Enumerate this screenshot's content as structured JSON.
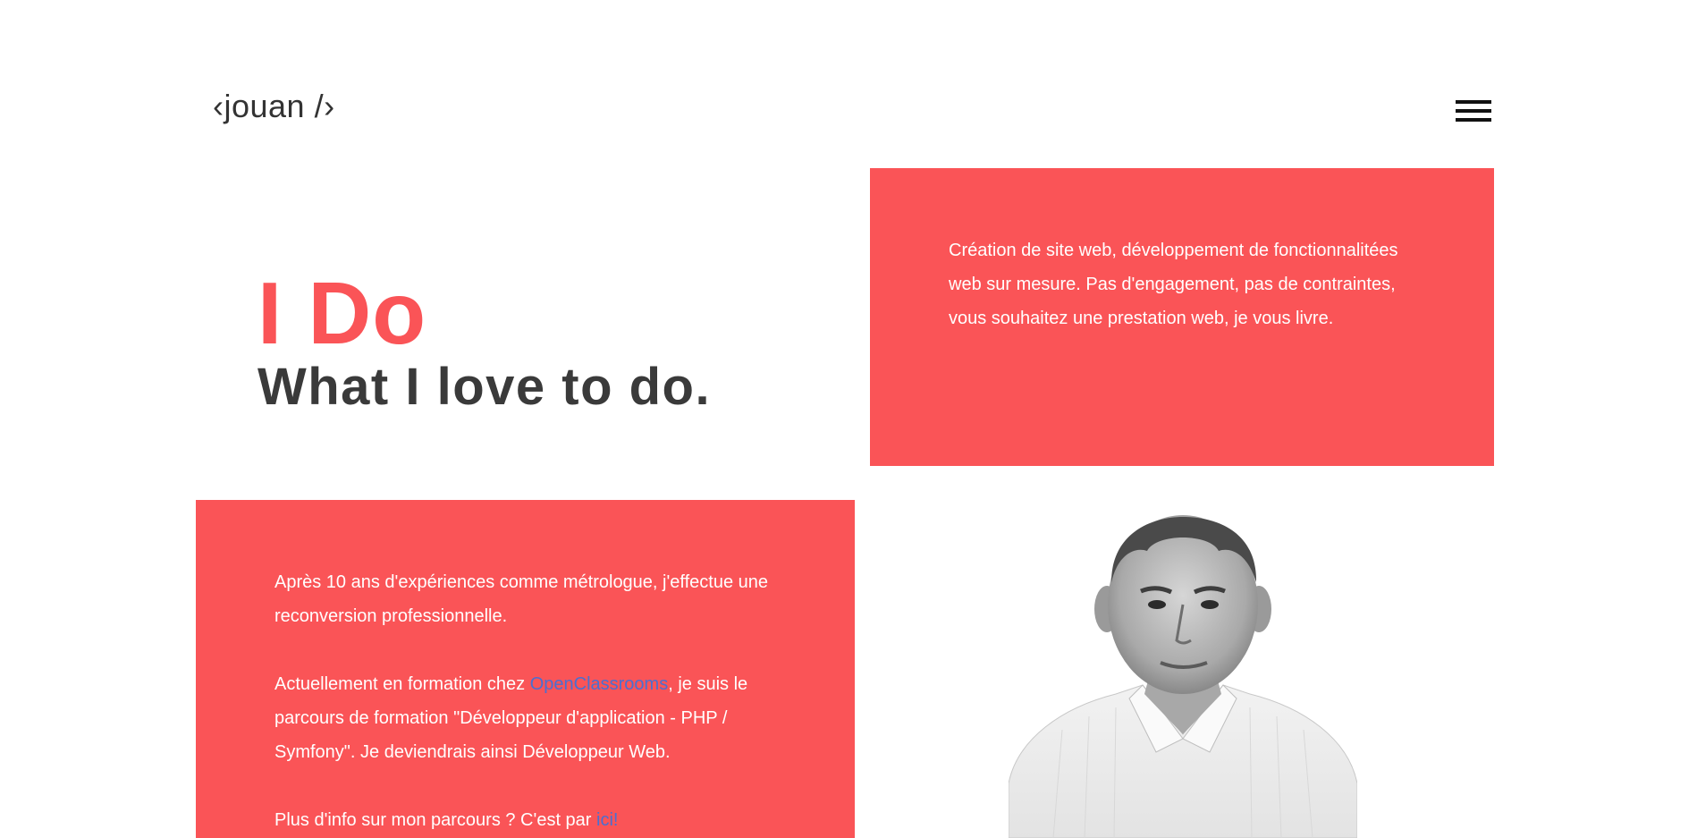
{
  "header": {
    "logo": "‹jouan /›",
    "menu_icon": "hamburger-menu-icon"
  },
  "hero": {
    "title": "I Do",
    "subtitle": "What I love to do."
  },
  "services": {
    "text": "Création de site web, développement de fonctionnalitées web sur mesure. Pas d'engagement, pas de contraintes, vous souhaitez une prestation web, je vous livre."
  },
  "about": {
    "paragraph1": "Après 10 ans d'expériences comme métrologue, j'effectue une reconversion professionnelle.",
    "paragraph2_before": "Actuellement en formation chez ",
    "paragraph2_link": "OpenClassrooms",
    "paragraph2_after": ", je suis le parcours de formation \"Développeur d'application - PHP / Symfony\". Je deviendrais ainsi Développeur Web.",
    "paragraph3_before": "Plus d'info sur mon parcours ? C'est par ",
    "paragraph3_link": "ici!"
  },
  "colors": {
    "accent": "#fa5457",
    "dark_text": "#3a3a3a",
    "link": "#4a6fd1"
  }
}
